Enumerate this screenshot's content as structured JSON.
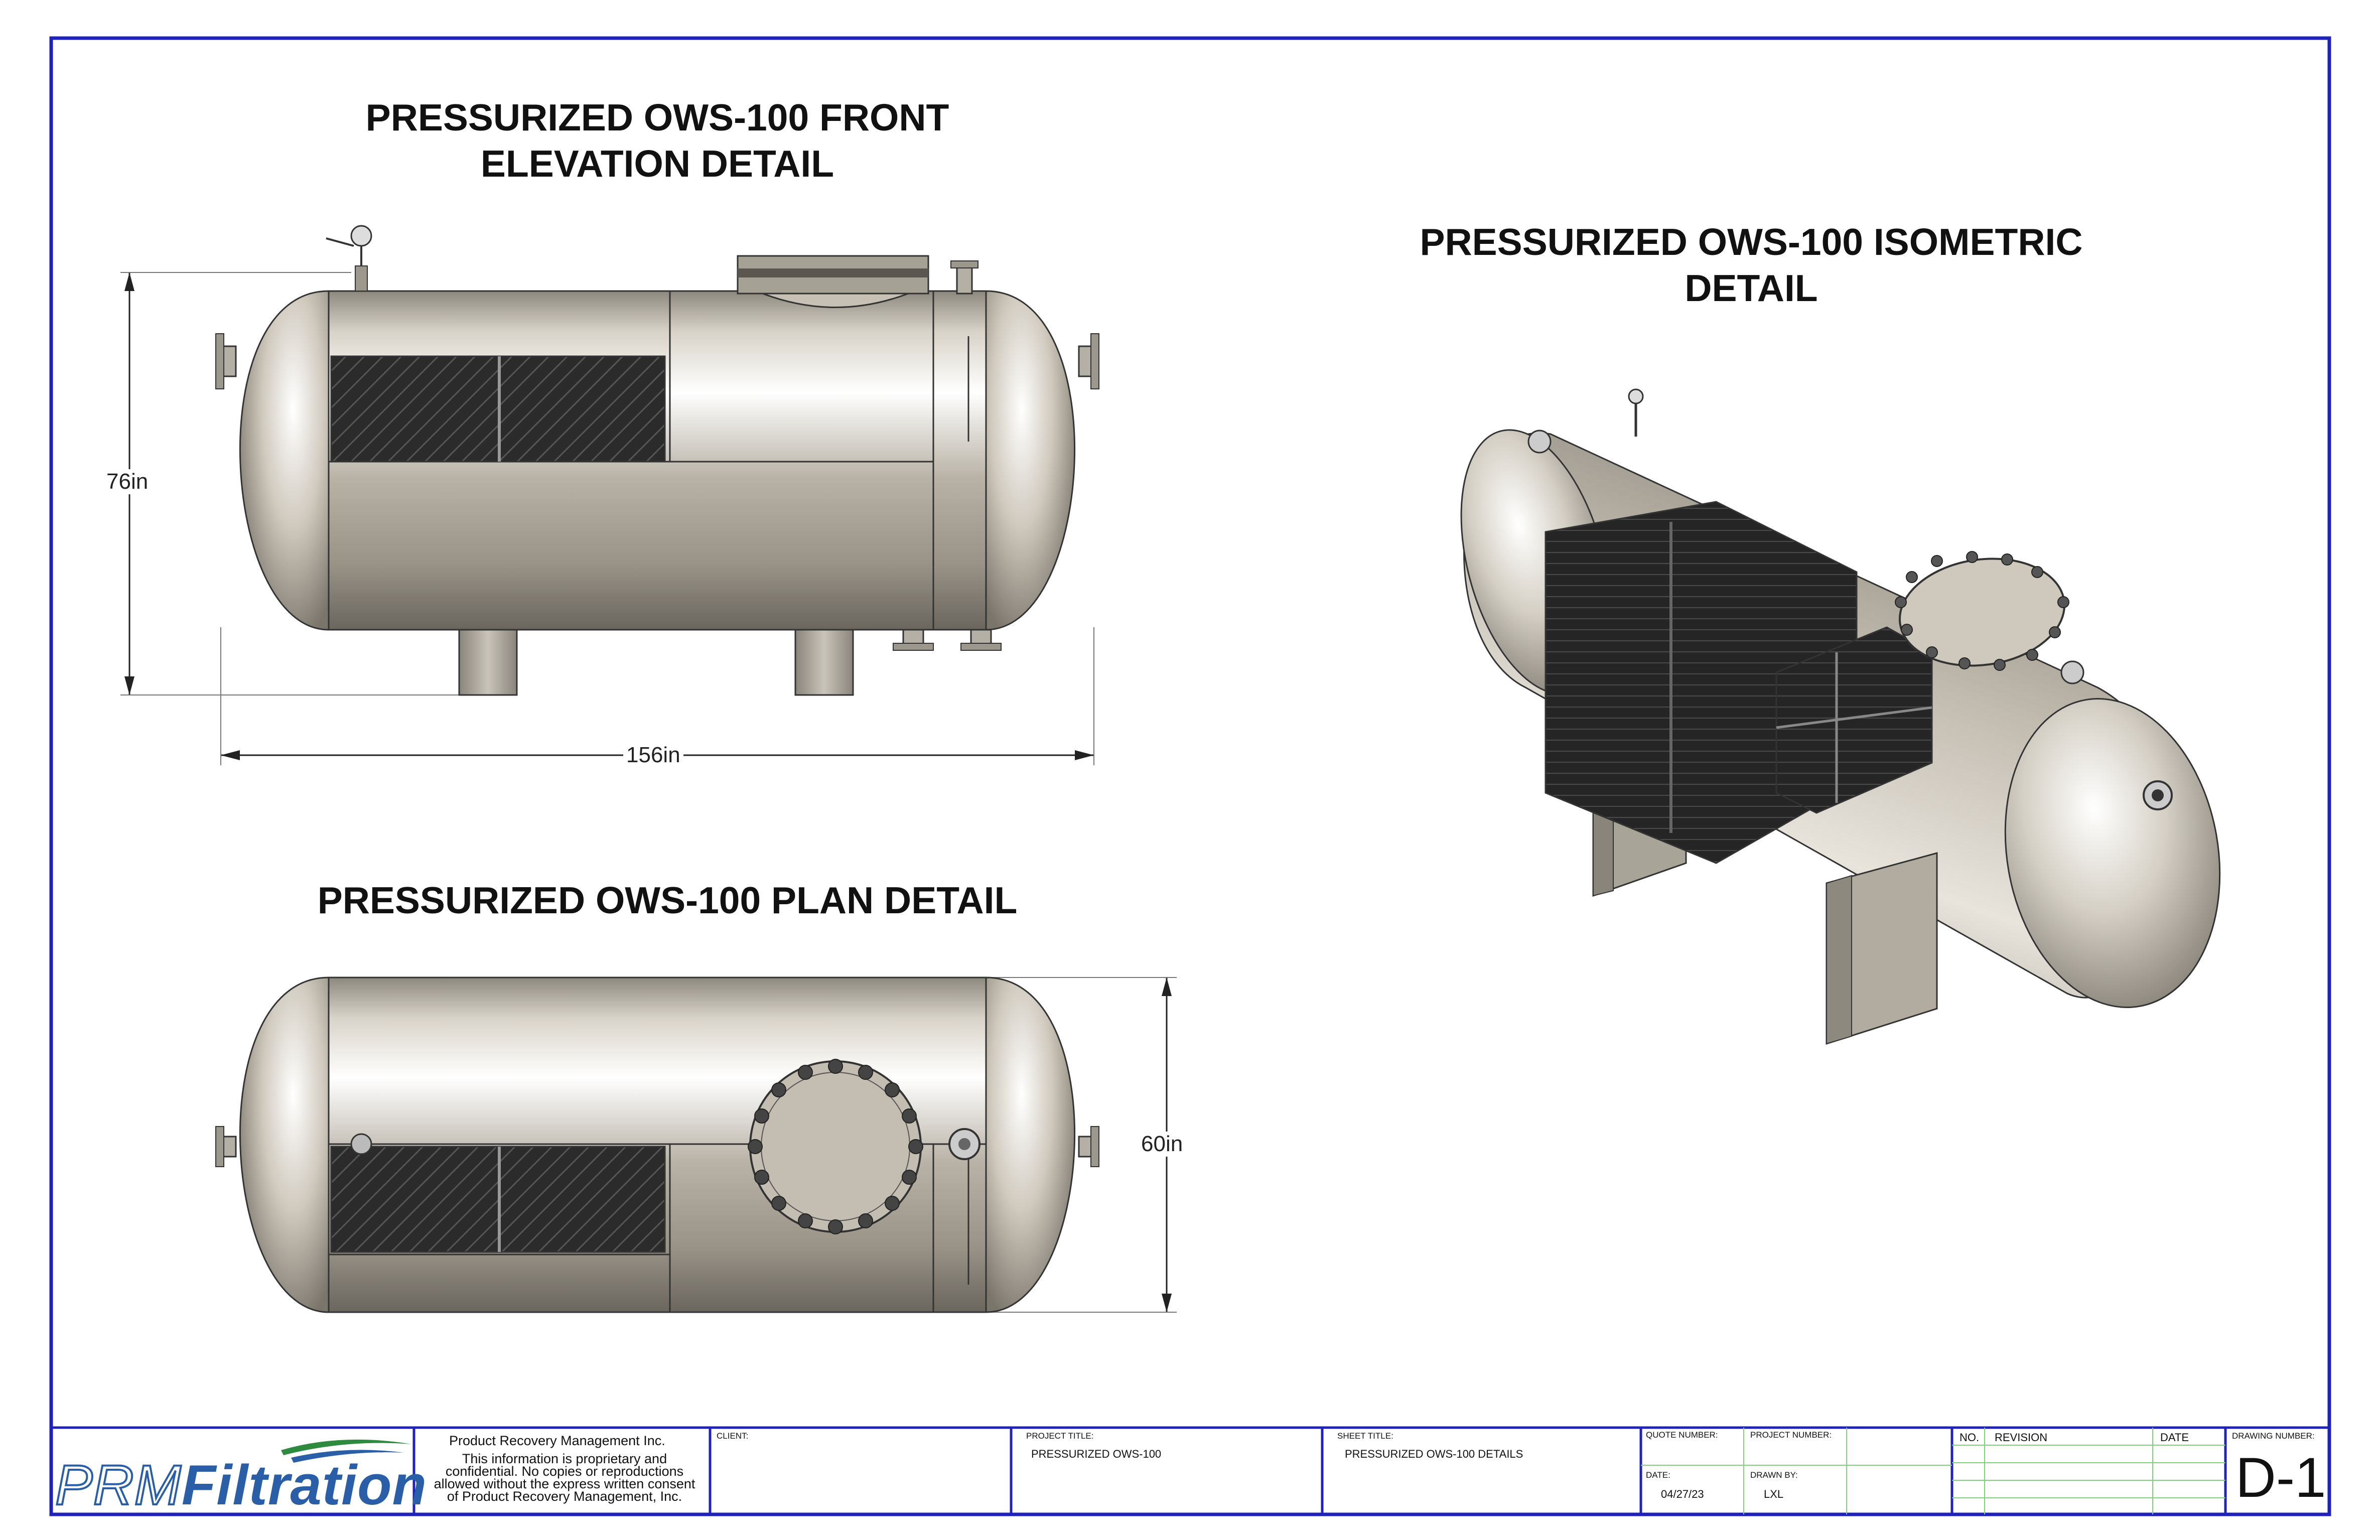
{
  "titles": {
    "front_line1": "PRESSURIZED OWS-100 FRONT",
    "front_line2": "ELEVATION DETAIL",
    "plan": "PRESSURIZED OWS-100 PLAN DETAIL",
    "iso_line1": "PRESSURIZED OWS-100 ISOMETRIC",
    "iso_line2": "DETAIL"
  },
  "dimensions": {
    "height": "76in",
    "length": "156in",
    "width": "60in"
  },
  "title_block": {
    "logo": {
      "part1": "PRM",
      "part2": "Filtration"
    },
    "company": "Product Recovery Management Inc.",
    "notice_lines": [
      "This information is proprietary and",
      "confidential. No copies or reproductions",
      "allowed without the express written consent",
      "of Product Recovery Management, Inc."
    ],
    "client_label": "CLIENT:",
    "client_value": "",
    "project_title_label": "PROJECT TITLE:",
    "project_title_value": "PRESSURIZED OWS-100",
    "sheet_title_label": "SHEET TITLE:",
    "sheet_title_value": "PRESSURIZED OWS-100 DETAILS",
    "quote_number_label": "QUOTE NUMBER:",
    "project_number_label": "PROJECT NUMBER:",
    "date_label": "DATE:",
    "date_value": "04/27/23",
    "drawn_by_label": "DRAWN BY:",
    "drawn_by_value": "LXL",
    "rev_no_label": "NO.",
    "revision_label": "REVISION",
    "rev_date_label": "DATE",
    "drawing_number_label": "DRAWING NUMBER:",
    "drawing_number_value": "D-1"
  },
  "colors": {
    "border": "#1f23b8",
    "logo_blue": "#2a5fa8",
    "logo_green": "#2e8a3e",
    "tank_steel": "#bdb7ab",
    "media_dark": "#2a2a2a",
    "grid_green": "#7fd07f"
  }
}
